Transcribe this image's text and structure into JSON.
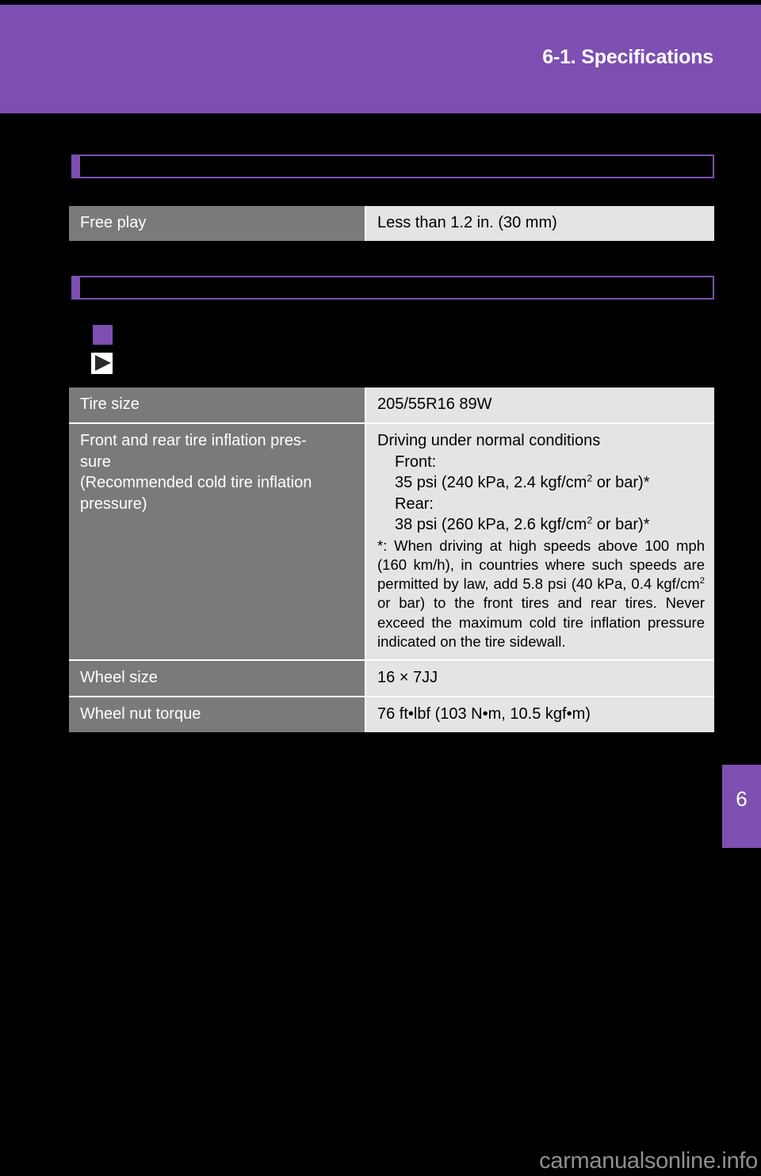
{
  "page": {
    "header_title": "6-1. Specifications",
    "side_tab_number": "6",
    "watermark": "carmanualsonline.info",
    "accent_color": "#7d4fb0",
    "label_cell_color": "#7a7a7a",
    "value_cell_color": "#e4e4e4"
  },
  "sections": [
    {
      "heading": "",
      "table": {
        "rows": [
          {
            "label": "Free play",
            "value": "Less than 1.2 in. (30 mm)"
          }
        ]
      }
    },
    {
      "heading": "",
      "markers": {
        "square_bullet_text": "",
        "arrow_marker_text": ""
      },
      "table": {
        "rows": [
          {
            "label": "Tire size",
            "value": "205/55R16 89W"
          },
          {
            "label": "Front and rear tire inflation pres-\nsure\n(Recommended cold tire inflation\npressure)",
            "value_lines": {
              "heading": "Driving under normal conditions",
              "front_label": "Front:",
              "front_value_pre": "35 psi (240 kPa, 2.4 kgf/cm",
              "front_value_sup": "2",
              "front_value_post": " or bar)*",
              "rear_label": "Rear:",
              "rear_value_pre": "38 psi (260 kPa, 2.6 kgf/cm",
              "rear_value_sup": "2",
              "rear_value_post": " or bar)*",
              "footnote_pre": "*: When driving at high speeds above 100 mph (160 km/h), in countries where such speeds are permitted by law, add 5.8 psi (40 kPa, 0.4 kgf/cm",
              "footnote_sup": "2",
              "footnote_post": " or bar) to the front tires and rear tires. Never exceed the maximum cold tire inflation pressure indicated on the tire sidewall."
            }
          },
          {
            "label": "Wheel size",
            "value": "16 × 7JJ"
          },
          {
            "label": "Wheel nut torque",
            "value": "76 ft•lbf (103 N•m, 10.5 kgf•m)"
          }
        ]
      }
    }
  ]
}
